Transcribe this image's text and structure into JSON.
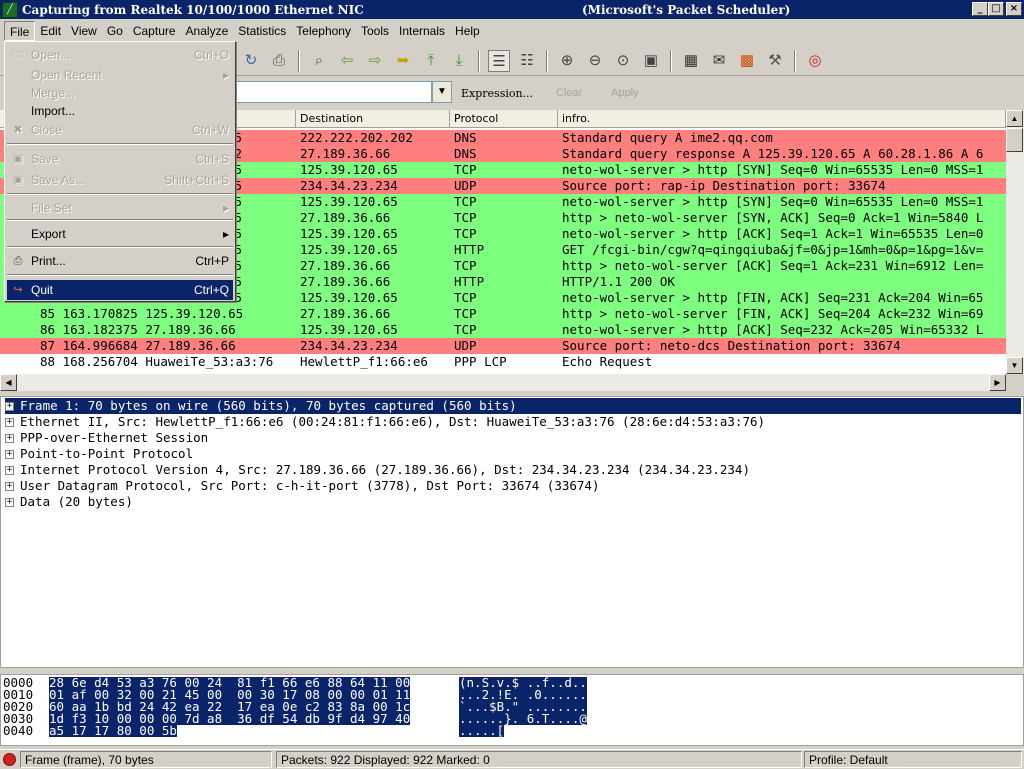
{
  "window": {
    "title_left": "Capturing from Realtek 10/100/1000 Ethernet NIC",
    "title_right": "(Microsoft's Packet Scheduler)",
    "minimize": "_",
    "maximize": "□",
    "close": "×"
  },
  "menubar": [
    "File",
    "Edit",
    "View",
    "Go",
    "Capture",
    "Analyze",
    "Statistics",
    "Telephony",
    "Tools",
    "Internals",
    "Help"
  ],
  "filter": {
    "expression": "Expression...",
    "clear": "Clear",
    "apply": "Apply"
  },
  "packet_list": {
    "columns": [
      "Destination",
      "Protocol",
      "infro."
    ],
    "rows": [
      {
        "left": "5",
        "dest": "222.222.202.202",
        "proto": "DNS",
        "info": "Standard query A ime2.qq.com",
        "color": "#ff7f7f"
      },
      {
        "left": "202",
        "dest": "27.189.36.66",
        "proto": "DNS",
        "info": "Standard query response A 125.39.120.65 A 60.28.1.86 A 6",
        "color": "#ff7f7f"
      },
      {
        "left": "5",
        "dest": "125.39.120.65",
        "proto": "TCP",
        "info": "neto-wol-server > http [SYN] Seq=0 Win=65535 Len=0 MSS=1",
        "color": "#7fff7f"
      },
      {
        "left": "5",
        "dest": "234.34.23.234",
        "proto": "UDP",
        "info": "Source port: rap-ip  Destination port: 33674",
        "color": "#ff7f7f"
      },
      {
        "left": "5",
        "dest": "125.39.120.65",
        "proto": "TCP",
        "info": "neto-wol-server > http [SYN] Seq=0 Win=65535 Len=0 MSS=1",
        "color": "#7fff7f"
      },
      {
        "left": "55",
        "dest": "27.189.36.66",
        "proto": "TCP",
        "info": "http > neto-wol-server [SYN, ACK] Seq=0 Ack=1 Win=5840 L",
        "color": "#7fff7f"
      },
      {
        "left": "5",
        "dest": "125.39.120.65",
        "proto": "TCP",
        "info": "neto-wol-server > http [ACK] Seq=1 Ack=1 Win=65535 Len=0",
        "color": "#7fff7f"
      },
      {
        "left": "5",
        "dest": "125.39.120.65",
        "proto": "HTTP",
        "info": "GET /fcgi-bin/cgw?q=qingqiuba&jf=0&jp=1&mh=0&p=1&pg=1&v=",
        "color": "#7fff7f"
      },
      {
        "left": "55",
        "dest": "27.189.36.66",
        "proto": "TCP",
        "info": "http > neto-wol-server [ACK] Seq=1 Ack=231 Win=6912 Len=",
        "color": "#7fff7f"
      },
      {
        "left": "55",
        "dest": "27.189.36.66",
        "proto": "HTTP",
        "info": "HTTP/1.1 200 OK",
        "color": "#7fff7f"
      },
      {
        "left": "5",
        "dest": "125.39.120.65",
        "proto": "TCP",
        "info": "neto-wol-server > http [FIN, ACK] Seq=231 Ack=204 Win=65",
        "color": "#7fff7f"
      },
      {
        "left": "85 163.170825 125.39.120.65",
        "dest": "27.189.36.66",
        "proto": "TCP",
        "info": "http > neto-wol-server [FIN, ACK] Seq=204 Ack=232 Win=69",
        "color": "#7fff7f"
      },
      {
        "left": "86 163.182375 27.189.36.66",
        "dest": "125.39.120.65",
        "proto": "TCP",
        "info": "neto-wol-server > http [ACK] Seq=232 Ack=205 Win=65332 L",
        "color": "#7fff7f"
      },
      {
        "left": "87 164.996684 27.189.36.66",
        "dest": "234.34.23.234",
        "proto": "UDP",
        "info": "Source port: neto-dcs  Destination port: 33674",
        "color": "#ff7f7f"
      },
      {
        "left": "88 168.256704 HuaweiTe_53:a3:76",
        "dest": "HewlettP_f1:66:e6",
        "proto": "PPP LCP",
        "info": "Echo Request",
        "color": "#ffffff"
      }
    ]
  },
  "details": [
    "Frame 1: 70 bytes on wire (560 bits), 70 bytes captured (560 bits)",
    "Ethernet II, Src: HewlettP_f1:66:e6 (00:24:81:f1:66:e6), Dst: HuaweiTe_53:a3:76 (28:6e:d4:53:a3:76)",
    "PPP-over-Ethernet Session",
    "Point-to-Point Protocol",
    "Internet Protocol Version 4, Src: 27.189.36.66 (27.189.36.66), Dst: 234.34.23.234 (234.34.23.234)",
    "User Datagram Protocol, Src Port: c-h-it-port (3778), Dst Port: 33674 (33674)",
    "Data (20 bytes)"
  ],
  "hex": [
    {
      "off": "0000",
      "hex": "28 6e d4 53 a3 76 00 24  81 f1 66 e6 88 64 11 00",
      "ascii": "(n.S.v.$ ..f..d.."
    },
    {
      "off": "0010",
      "hex": "01 af 00 32 00 21 45 00  00 30 17 08 00 00 01 11",
      "ascii": "...2.!E. .0......"
    },
    {
      "off": "0020",
      "hex": "60 aa 1b bd 24 42 ea 22  17 ea 0e c2 83 8a 00 1c",
      "ascii": "`...$B.\" ........"
    },
    {
      "off": "0030",
      "hex": "1d f3 10 00 00 00 7d a8  36 df 54 db 9f d4 97 40",
      "ascii": "......}. 6.T....@"
    },
    {
      "off": "0040",
      "hex": "a5 17 17 80 00 5b",
      "ascii": ".....["
    }
  ],
  "status": {
    "frame": "Frame (frame), 70 bytes",
    "packets": "Packets: 922 Displayed: 922 Marked: 0",
    "profile": "Profile: Default"
  },
  "file_menu": {
    "open": {
      "label": "Open...",
      "shortcut": "Ctrl+O"
    },
    "open_recent": {
      "label": "Open Recent"
    },
    "merge": {
      "label": "Merge..."
    },
    "import": {
      "label": "Import..."
    },
    "close": {
      "label": "Close",
      "shortcut": "Ctrl+W"
    },
    "save": {
      "label": "Save",
      "shortcut": "Ctrl+S"
    },
    "save_as": {
      "label": "Save As...",
      "shortcut": "Shift+Ctrl+S"
    },
    "file_set": {
      "label": "File Set"
    },
    "export": {
      "label": "Export"
    },
    "print": {
      "label": "Print...",
      "shortcut": "Ctrl+P"
    },
    "quit": {
      "label": "Quit",
      "shortcut": "Ctrl+Q"
    }
  },
  "icons": [
    "reload-icon",
    "print-icon",
    "find-icon",
    "back-icon",
    "forward-icon",
    "go-to-icon",
    "top-icon",
    "bottom-icon",
    "colorize-icon",
    "autoscroll-icon",
    "zoom-in-icon",
    "zoom-out-icon",
    "zoom-normal-icon",
    "resize-columns-icon",
    "capture-filters-icon",
    "display-filters-icon",
    "coloring-rules-icon",
    "preferences-icon",
    "help-icon"
  ]
}
